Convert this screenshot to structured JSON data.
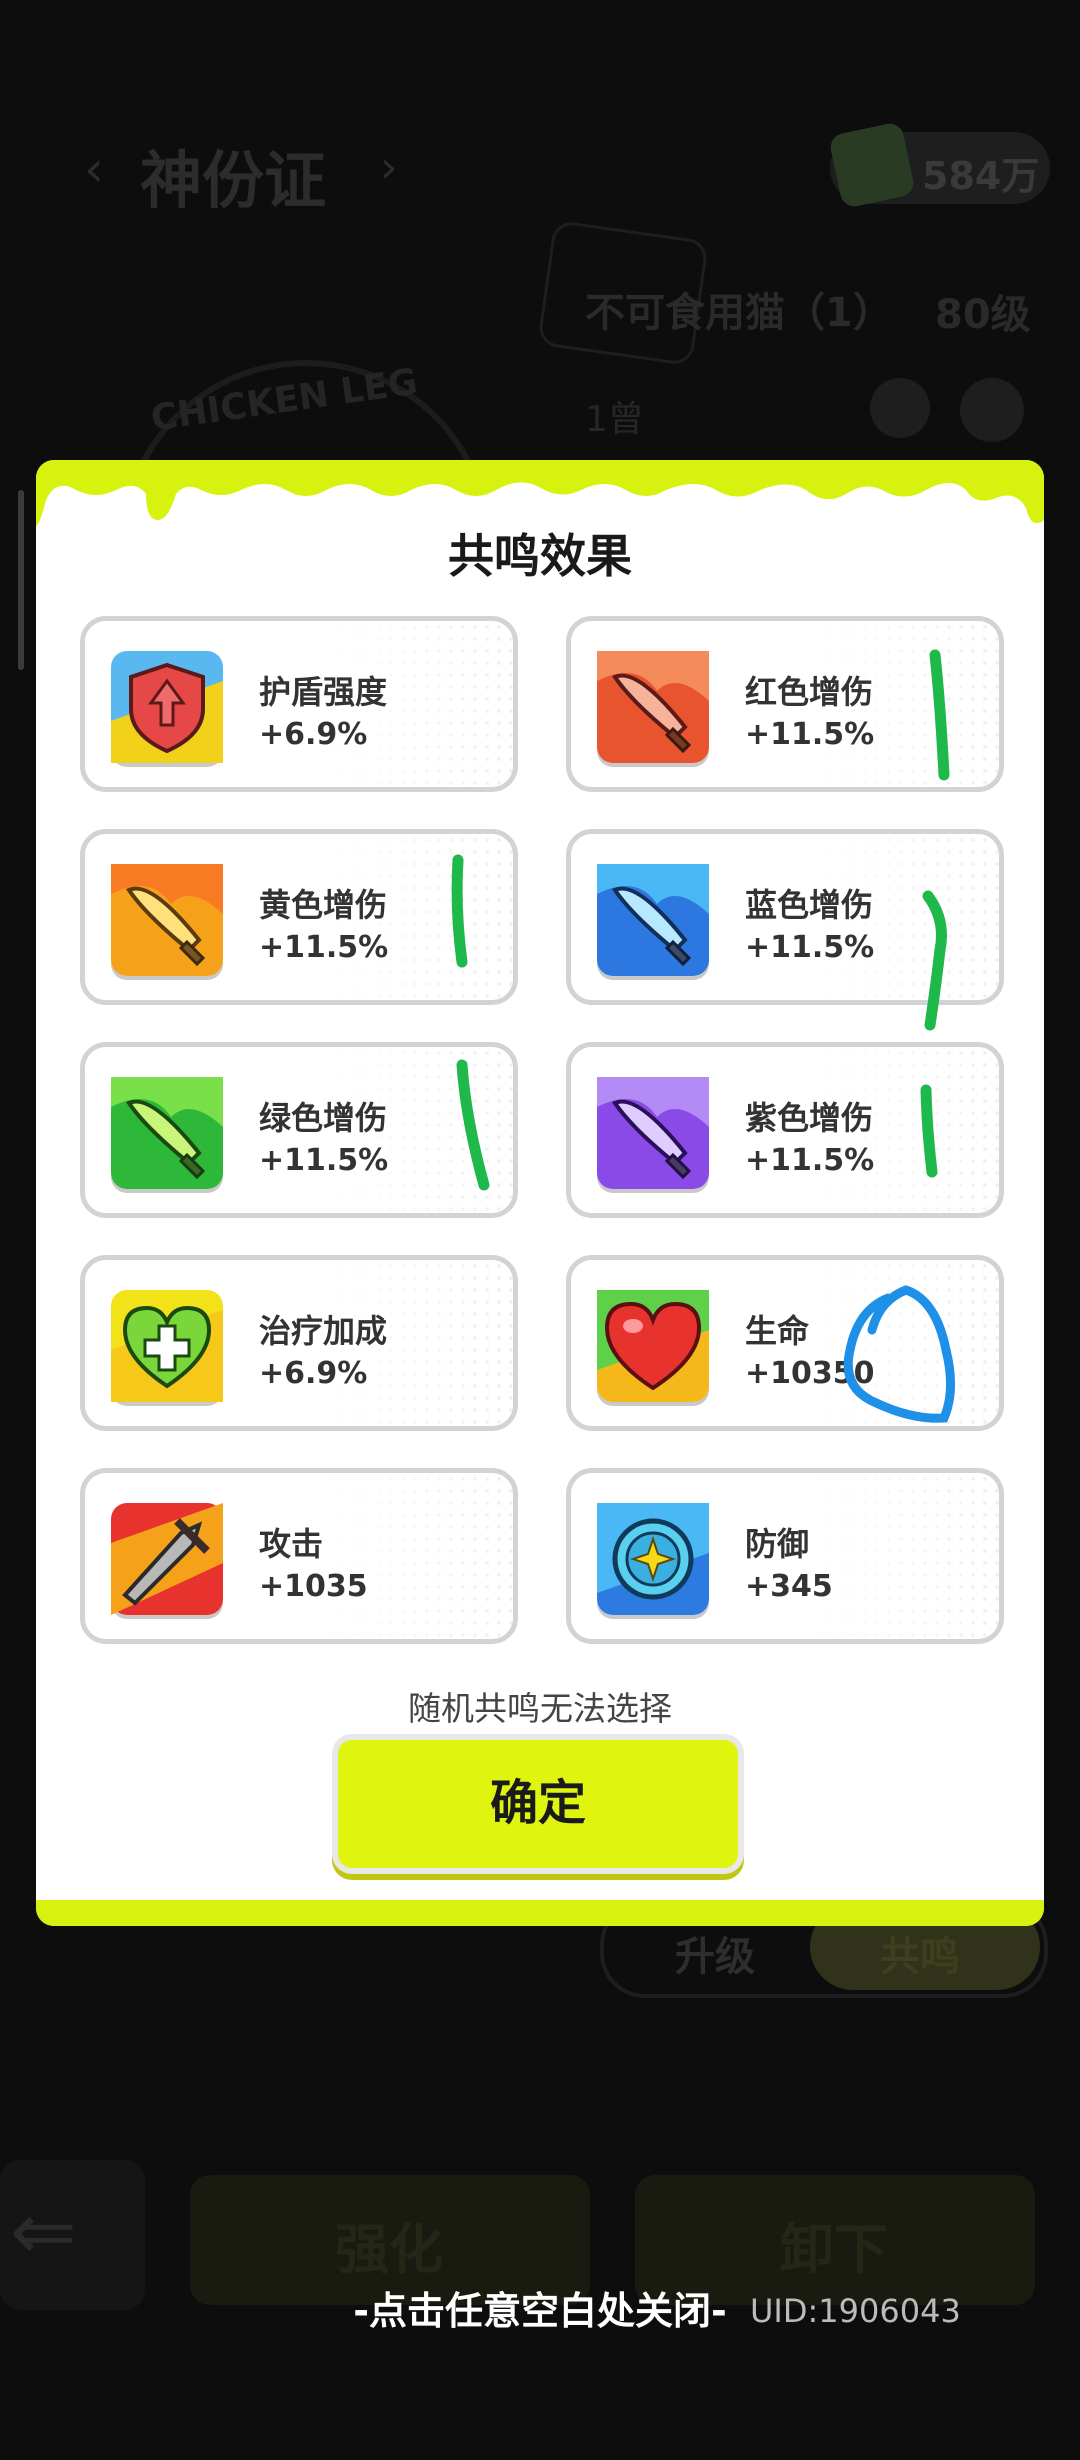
{
  "background": {
    "page_title": "神份证",
    "coins": "584万",
    "item_name": "不可食用猫（1）",
    "item_level": "80级",
    "stage": "1曾",
    "badge_text": "CHICKEN LEG",
    "tabs": [
      "升级",
      "共鸣"
    ],
    "buttons": [
      "强化",
      "卸下"
    ]
  },
  "modal": {
    "title": "共鸣效果",
    "cards": [
      {
        "name": "护盾强度",
        "value": "+6.9%",
        "icon": "shield-icon"
      },
      {
        "name": "红色增伤",
        "value": "+11.5%",
        "icon": "red-blade-icon"
      },
      {
        "name": "黄色增伤",
        "value": "+11.5%",
        "icon": "yellow-blade-icon"
      },
      {
        "name": "蓝色增伤",
        "value": "+11.5%",
        "icon": "blue-blade-icon"
      },
      {
        "name": "绿色增伤",
        "value": "+11.5%",
        "icon": "green-blade-icon"
      },
      {
        "name": "紫色增伤",
        "value": "+11.5%",
        "icon": "purple-blade-icon"
      },
      {
        "name": "治疗加成",
        "value": "+6.9%",
        "icon": "heal-heart-icon"
      },
      {
        "name": "生命",
        "value": "+10350",
        "icon": "heart-icon"
      },
      {
        "name": "攻击",
        "value": "+1035",
        "icon": "sword-icon"
      },
      {
        "name": "防御",
        "value": "+345",
        "icon": "defense-coin-icon"
      }
    ],
    "hint": "随机共鸣无法选择",
    "confirm_label": "确定"
  },
  "close_hint": "-点击任意空白处关闭-",
  "uid": "UID:1906043",
  "colors": {
    "accent": "#d6f20e",
    "overlay": "#0d0d0d",
    "annotation_green": "#1fb84a",
    "annotation_blue": "#1e90e8"
  }
}
